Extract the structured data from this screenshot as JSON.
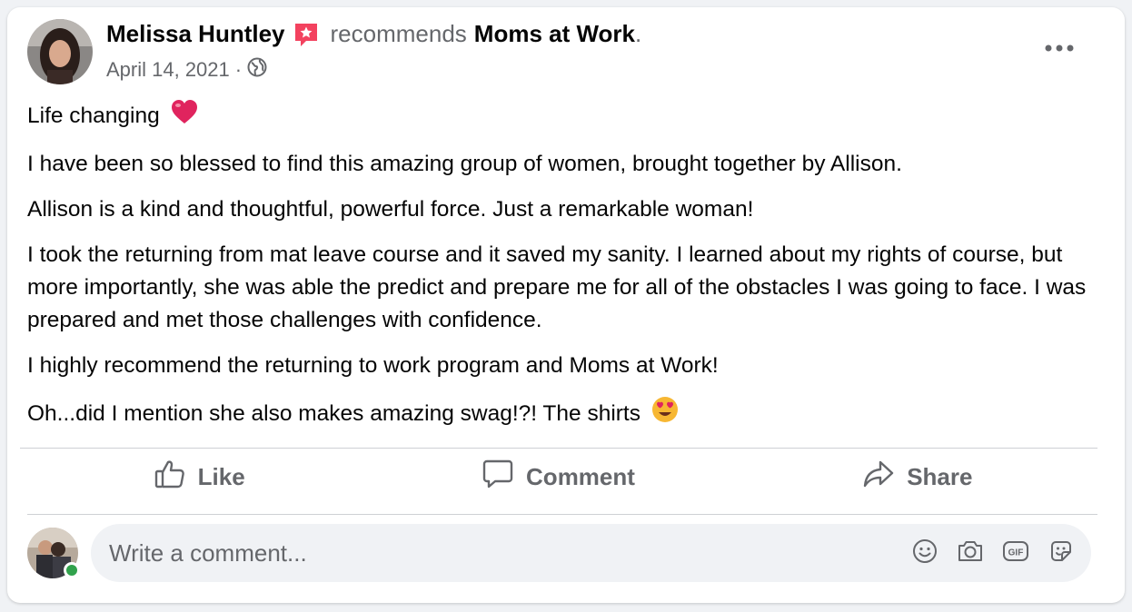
{
  "colors": {
    "text_primary": "#050505",
    "text_secondary": "#65676b",
    "divider": "#ced0d4",
    "badge": "#f3425f",
    "heart": "#e0245e",
    "online": "#31a24c",
    "comment_bg": "#f0f2f5"
  },
  "post": {
    "author": "Melissa Huntley",
    "author_badge_icon": "recommendation-star-icon",
    "action_text": "recommends",
    "page_name": "Moms at Work",
    "period": ".",
    "date": "April 14, 2021",
    "separator": "·",
    "privacy_icon": "globe-icon",
    "more_icon": "ellipsis-icon",
    "paragraphs": [
      "Life changing",
      "I have been so blessed to find this amazing group of women, brought together by Allison.",
      "Allison is a kind and thoughtful, powerful force. Just a remarkable woman!",
      "I took the returning from mat leave course and it saved my sanity. I learned about my rights of course, but more importantly, she was able the predict and prepare me for all of the obstacles I was going to face. I was prepared and met those challenges with confidence.",
      "I highly recommend the returning to work program and Moms at Work!",
      "Oh...did I mention she also makes amazing swag!?! The shirts"
    ],
    "emoji_1": "heart-emoji",
    "emoji_2": "heart-eyes-emoji"
  },
  "actions": {
    "like_label": "Like",
    "comment_label": "Comment",
    "share_label": "Share"
  },
  "comment": {
    "placeholder": "Write a comment...",
    "buttons": [
      "emoji-icon",
      "camera-icon",
      "gif-icon",
      "sticker-icon"
    ]
  }
}
